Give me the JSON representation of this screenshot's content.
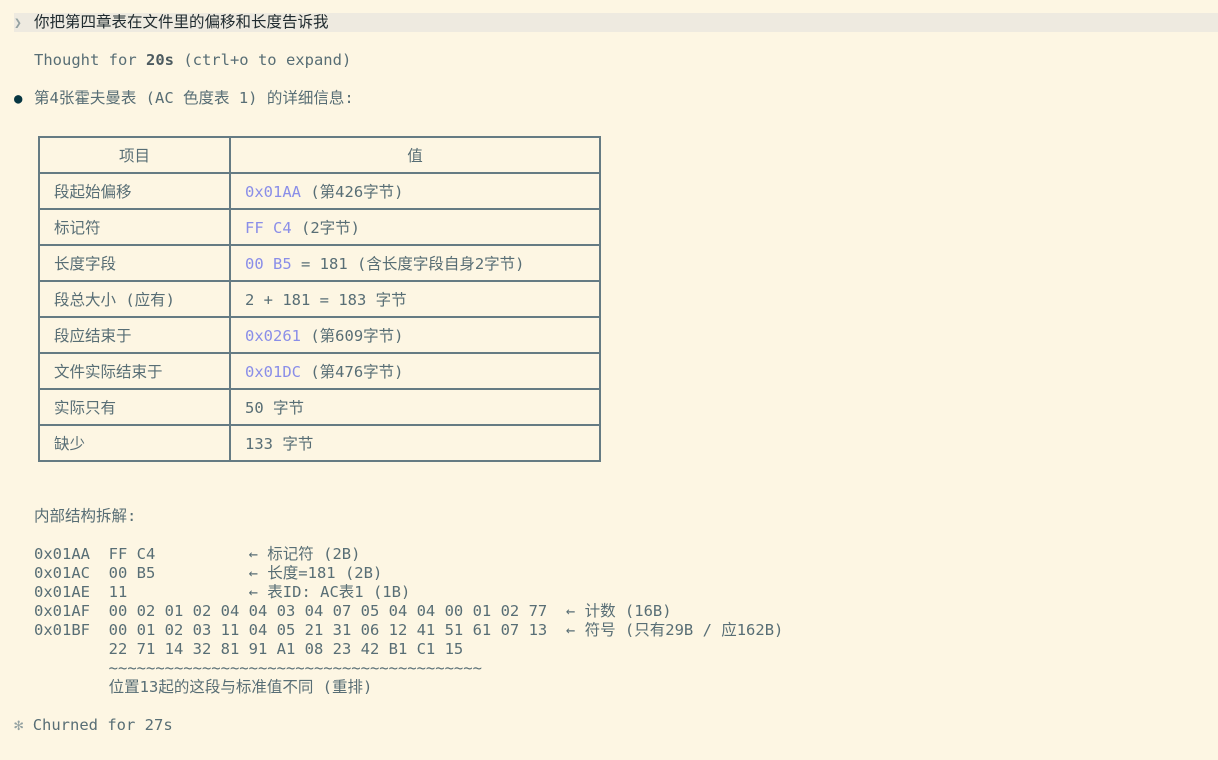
{
  "prompt": {
    "chevron": "❯",
    "text": "你把第四章表在文件里的偏移和长度告诉我"
  },
  "thought": {
    "prefix": "Thought for ",
    "duration": "20s",
    "suffix": " (ctrl+o to expand)"
  },
  "response": {
    "bullet": "●",
    "heading": "第4张霍夫曼表 (AC 色度表 1) 的详细信息:"
  },
  "table": {
    "headers": [
      "项目",
      "值"
    ],
    "rows": [
      {
        "label": "段起始偏移",
        "hex": "0x01AA",
        "rest": " (第426字节)"
      },
      {
        "label": "标记符",
        "hex": "FF C4",
        "rest": " (2字节)"
      },
      {
        "label": "长度字段",
        "hex": "00 B5",
        "rest": " = 181 (含长度字段自身2字节)"
      },
      {
        "label": "段总大小 (应有)",
        "hex": "",
        "rest": "2 + 181 = 183 字节"
      },
      {
        "label": "段应结束于",
        "hex": "0x0261",
        "rest": " (第609字节)"
      },
      {
        "label": "文件实际结束于",
        "hex": "0x01DC",
        "rest": " (第476字节)"
      },
      {
        "label": "实际只有",
        "hex": "",
        "rest": "50 字节"
      },
      {
        "label": "缺少",
        "hex": "",
        "rest": "133 字节"
      }
    ]
  },
  "breakdown": {
    "title": "内部结构拆解:",
    "lines": [
      "0x01AA  FF C4          ← 标记符 (2B)",
      "0x01AC  00 B5          ← 长度=181 (2B)",
      "0x01AE  11             ← 表ID: AC表1 (1B)",
      "0x01AF  00 02 01 02 04 04 03 04 07 05 04 04 00 01 02 77  ← 计数 (16B)",
      "0x01BF  00 01 02 03 11 04 05 21 31 06 12 41 51 61 07 13  ← 符号 (只有29B / 应162B)",
      "        22 71 14 32 81 91 A1 08 23 42 B1 C1 15",
      "        ~~~~~~~~~~~~~~~~~~~~~~~~~~~~~~~~~~~~~~~~",
      "        位置13起的这段与标准值不同 (重排)"
    ]
  },
  "status": {
    "star": "✻",
    "text": "Churned for 27s"
  }
}
